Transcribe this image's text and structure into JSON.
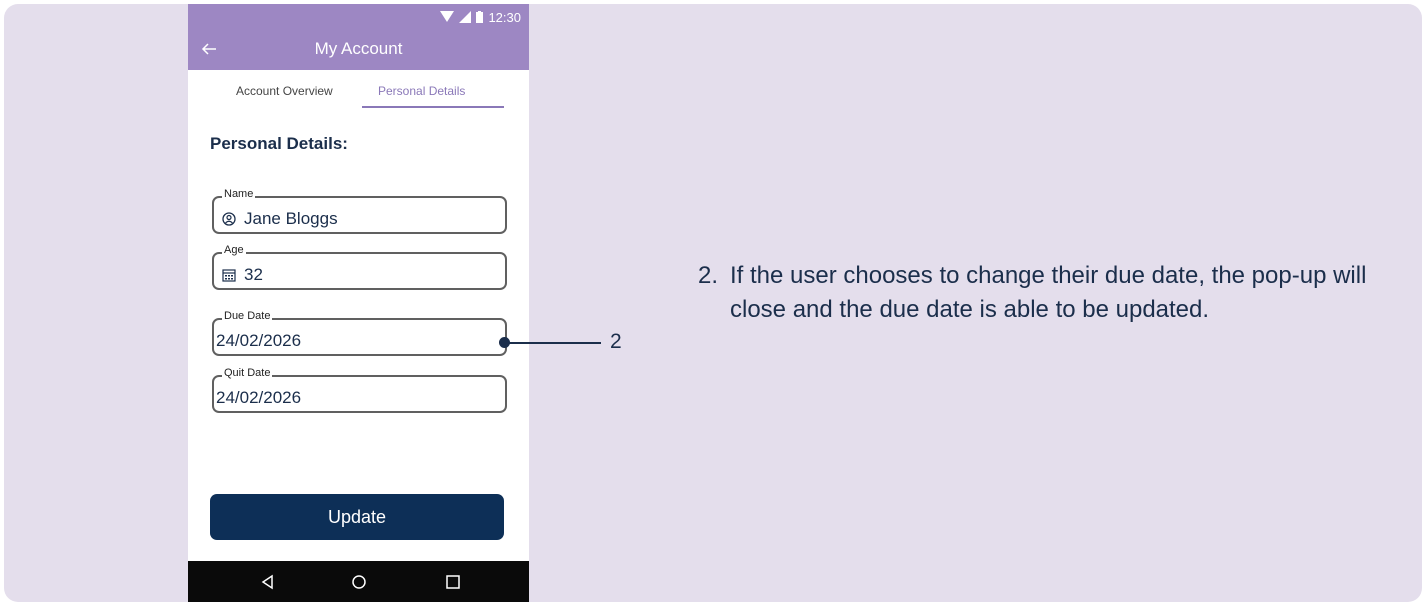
{
  "status_bar": {
    "time": "12:30"
  },
  "app_bar": {
    "title": "My Account"
  },
  "tabs": [
    {
      "label": "Account Overview",
      "active": false
    },
    {
      "label": "Personal Details",
      "active": true
    }
  ],
  "section_title": "Personal Details:",
  "fields": {
    "name": {
      "label": "Name",
      "value": "Jane Bloggs",
      "icon": "person-circle-icon"
    },
    "age": {
      "label": "Age",
      "value": "32",
      "icon": "calendar-icon"
    },
    "due_date": {
      "label": "Due Date",
      "value": "24/02/2026"
    },
    "quit_date": {
      "label": "Quit Date",
      "value": "24/02/2026"
    }
  },
  "update_button": {
    "label": "Update"
  },
  "nav_bar": {
    "icons": [
      "back-triangle-icon",
      "home-circle-icon",
      "recents-square-icon"
    ]
  },
  "callout": {
    "number": "2",
    "note_number": "2.",
    "note_text": "If the user chooses to change their due date, the pop-up will close and the due date is able to be updated."
  },
  "colors": {
    "app_bar": "#9d87c3",
    "primary_navy": "#0d2f57",
    "background": "#e4deec",
    "active_tab": "#8a78b8"
  }
}
